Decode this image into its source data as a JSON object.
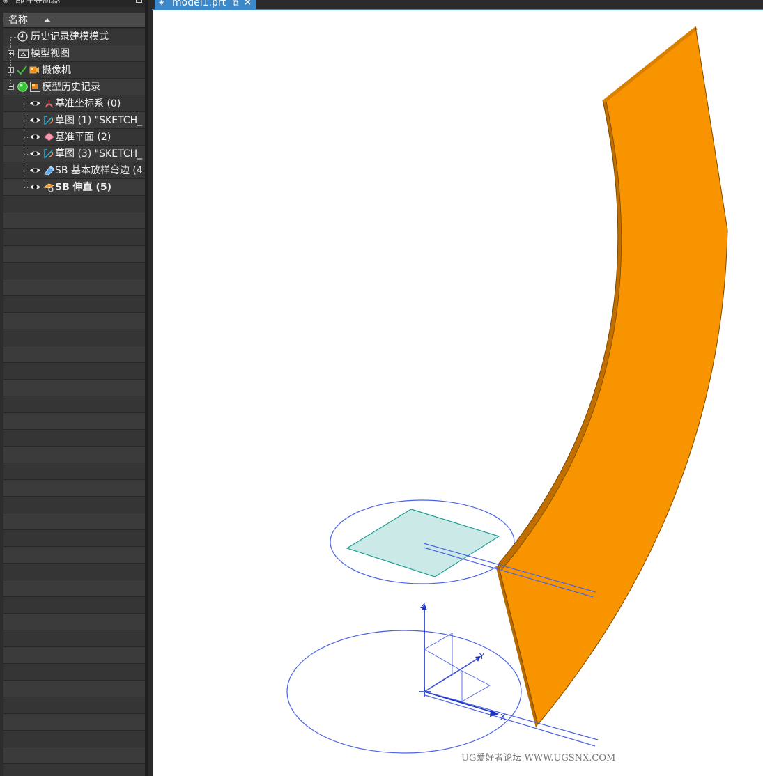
{
  "navigator": {
    "title": "部件导航器",
    "column_header": "名称",
    "items": [
      {
        "label": "历史记录建模模式",
        "icon": "clock-icon"
      },
      {
        "label": "模型视图",
        "icon": "model-views-icon"
      },
      {
        "label": "摄像机",
        "icon": "camera-icon"
      },
      {
        "label": "模型历史记录",
        "icon": "model-history-icon"
      },
      {
        "label": "基准坐标系 (0)",
        "icon": "datum-csys-icon"
      },
      {
        "label": "草图 (1) \"SKETCH_",
        "icon": "sketch-icon"
      },
      {
        "label": "基准平面 (2)",
        "icon": "datum-plane-icon"
      },
      {
        "label": "草图 (3) \"SKETCH_",
        "icon": "sketch-icon"
      },
      {
        "label": "SB 基本放样弯边 (4",
        "icon": "lofted-flange-icon"
      },
      {
        "label": "SB 伸直 (5)",
        "icon": "unbend-icon"
      }
    ]
  },
  "tab": {
    "label": "model1.prt"
  },
  "viewport": {
    "axis_labels": {
      "x": "X",
      "y": "Y",
      "z": "Z"
    },
    "watermark": "UG爱好者论坛 WWW.UGSNX.COM",
    "colors": {
      "sheet_face": "#f79400",
      "sheet_edge": "#c06e00",
      "datum_plane": "#cbe9e7",
      "datum_plane_edge": "#1d9e94",
      "csys_lines": "#4a63e6"
    }
  }
}
